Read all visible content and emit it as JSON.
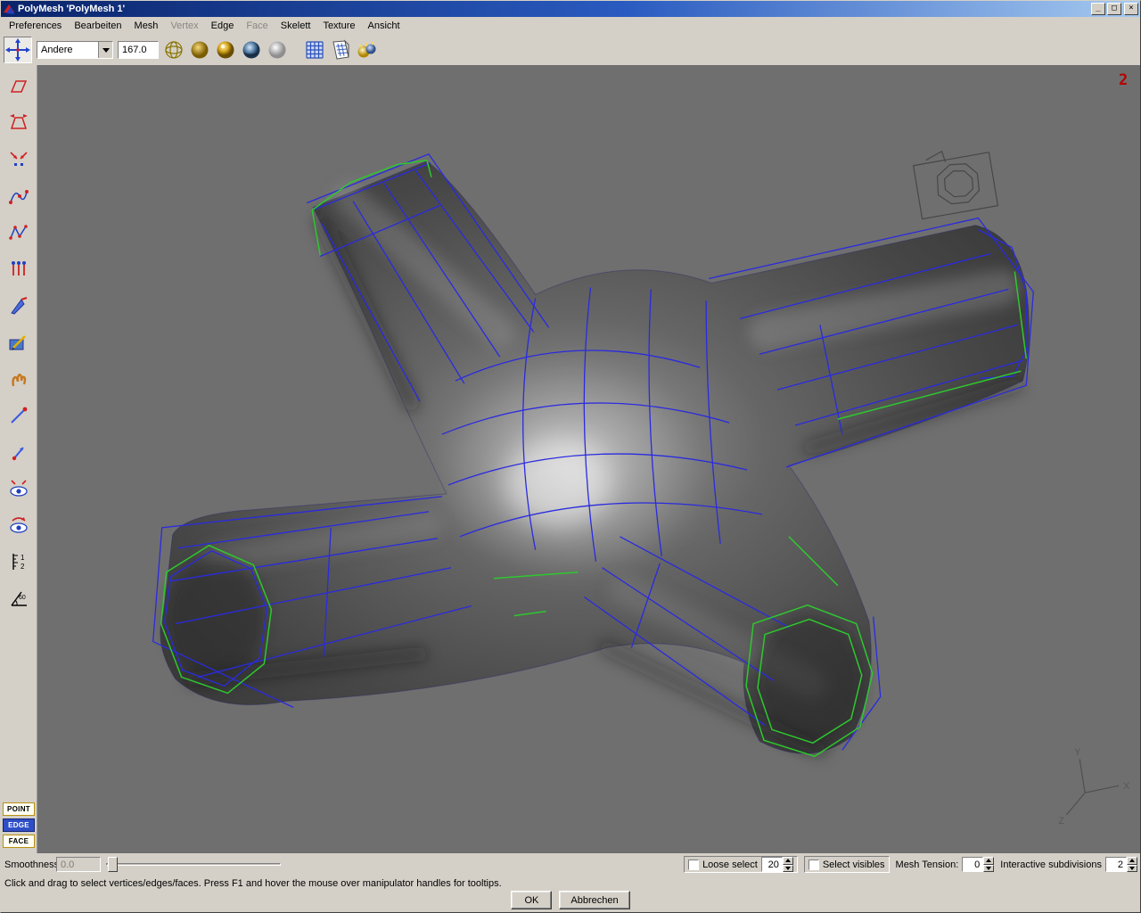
{
  "window": {
    "title": "PolyMesh 'PolyMesh 1'",
    "minimize_glyph": "_",
    "maximize_glyph": "□",
    "close_glyph": "×"
  },
  "menubar": {
    "items": [
      {
        "label": "Preferences",
        "enabled": true
      },
      {
        "label": "Bearbeiten",
        "enabled": true
      },
      {
        "label": "Mesh",
        "enabled": true
      },
      {
        "label": "Vertex",
        "enabled": false
      },
      {
        "label": "Edge",
        "enabled": true
      },
      {
        "label": "Face",
        "enabled": false
      },
      {
        "label": "Skelett",
        "enabled": true
      },
      {
        "label": "Texture",
        "enabled": true
      },
      {
        "label": "Ansicht",
        "enabled": true
      }
    ]
  },
  "toolbar": {
    "falloff_dropdown": {
      "value": "Andere"
    },
    "angle_field": {
      "value": "167.0"
    },
    "icons": [
      {
        "name": "wireframe-sphere-icon"
      },
      {
        "name": "flat-shaded-sphere-icon"
      },
      {
        "name": "smooth-shaded-sphere-icon"
      },
      {
        "name": "textured-sphere-icon"
      },
      {
        "name": "matte-sphere-icon"
      },
      {
        "name": "grid-icon"
      },
      {
        "name": "uv-view-icon"
      },
      {
        "name": "lights-icon"
      }
    ]
  },
  "tools": {
    "selected": "translate-tool",
    "items": [
      {
        "name": "translate-tool"
      },
      {
        "name": "skew-tool"
      },
      {
        "name": "taper-tool"
      },
      {
        "name": "bend-tool"
      },
      {
        "name": "magnet-curve-tool"
      },
      {
        "name": "lattice-tool"
      },
      {
        "name": "comb-tool"
      },
      {
        "name": "knife-tool"
      },
      {
        "name": "draw-tool"
      },
      {
        "name": "claw-tool"
      },
      {
        "name": "needle-tool"
      },
      {
        "name": "pin-tool"
      },
      {
        "name": "show-eye-tool"
      },
      {
        "name": "rotate-eye-tool"
      },
      {
        "name": "measure-tool"
      },
      {
        "name": "angle-tool"
      }
    ],
    "measure_glyph_1": "1",
    "measure_glyph_2": "2",
    "angle_glyph": "60"
  },
  "mode_buttons": [
    {
      "label": "POINT",
      "selected": false
    },
    {
      "label": "EDGE",
      "selected": true
    },
    {
      "label": "FACE",
      "selected": false
    }
  ],
  "viewport": {
    "overlay_badge": "2",
    "axes": {
      "x": "X",
      "y": "Y",
      "z": "Z"
    }
  },
  "bottom_panel": {
    "smoothness": {
      "label": "Smoothness",
      "value": "0.0"
    },
    "loose_select": {
      "label": "Loose select",
      "checked": false,
      "value": "20"
    },
    "select_visibles": {
      "label": "Select visibles",
      "checked": false
    },
    "mesh_tension": {
      "label": "Mesh Tension:",
      "value": "0"
    },
    "interactive_subdivisions": {
      "label": "Interactive subdivisions",
      "value": "2"
    },
    "status_text": "Click and drag to select vertices/edges/faces. Press F1 and hover the mouse over manipulator handles for tooltips.",
    "buttons": {
      "ok": "OK",
      "cancel": "Abbrechen"
    }
  },
  "colors": {
    "titlebar_left": "#0a246a",
    "titlebar_right": "#a6caf0",
    "chrome": "#d4d0c8",
    "viewport_bg": "#6f6f6f",
    "wire_blue": "#2a2ae0",
    "wire_green": "#2ec82e",
    "badge_red": "#b40000"
  }
}
